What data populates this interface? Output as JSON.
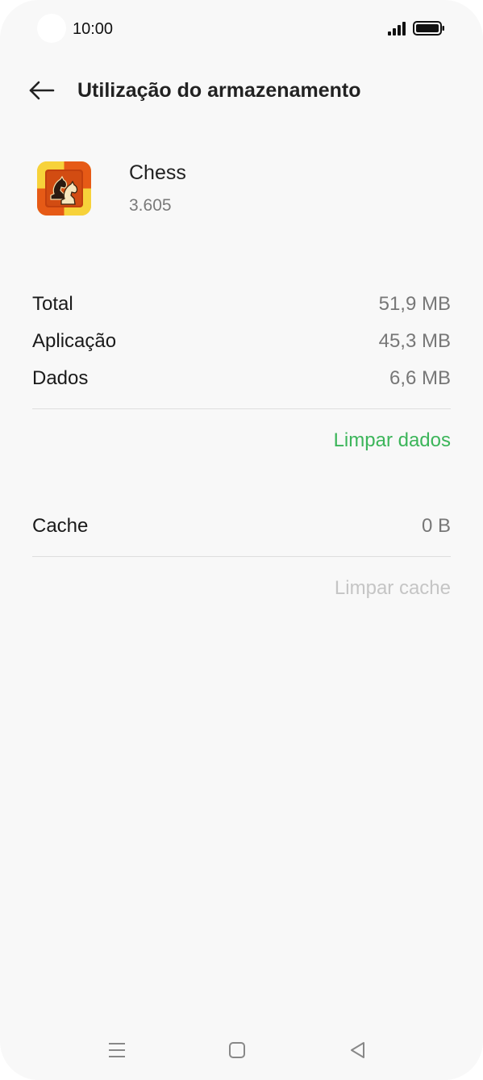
{
  "status_bar": {
    "time": "10:00",
    "signal_icon": "signal-icon",
    "battery_icon": "battery-icon"
  },
  "header": {
    "back_icon": "back-arrow-icon",
    "title": "Utilização do armazenamento"
  },
  "app": {
    "icon": "chess-app-icon",
    "name": "Chess",
    "version": "3.605"
  },
  "storage": {
    "rows": [
      {
        "label": "Total",
        "value": "51,9 MB"
      },
      {
        "label": "Aplicação",
        "value": "45,3 MB"
      },
      {
        "label": "Dados",
        "value": "6,6 MB"
      }
    ],
    "clear_data_label": "Limpar dados"
  },
  "cache": {
    "label": "Cache",
    "value": "0 B",
    "clear_cache_label": "Limpar cache"
  },
  "colors": {
    "accent": "#3cb55a",
    "disabled": "#c5c5c5",
    "background": "#f8f8f8"
  },
  "nav_bar": {
    "menu_icon": "menu-icon",
    "home_icon": "home-icon",
    "back_icon": "nav-back-icon"
  }
}
